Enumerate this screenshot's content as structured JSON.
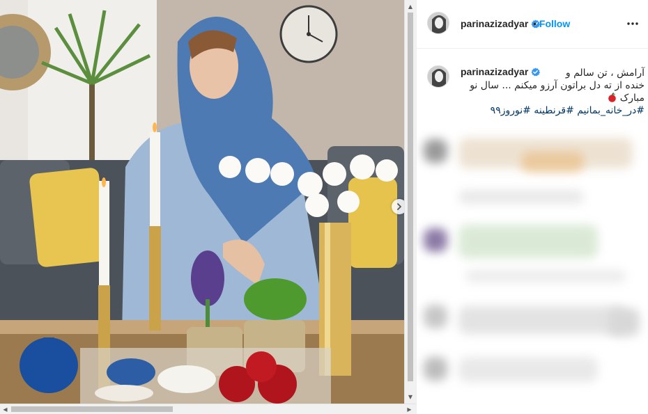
{
  "post": {
    "username": "parinazizadyar",
    "follow_separator": "•",
    "follow_label": "Follow",
    "caption_line1": "آرامش ، تن سالم و",
    "caption_line2": "خنده از ته دل براتون آرزو میکنم ... سال نو",
    "caption_line3": "مبارک",
    "hashtags": "#در_خانه_بمانیم #قرنطینه #نوروز۹۹"
  },
  "icons": {
    "verified": "verified-badge-icon",
    "more": "more-options-icon",
    "next": "chevron-right-icon",
    "emoji": "red-apple-icon",
    "scroll_up": "scroll-up-arrow-icon",
    "scroll_down": "scroll-down-arrow-icon",
    "scroll_left": "scroll-left-arrow-icon",
    "scroll_right": "scroll-right-arrow-icon"
  },
  "colors": {
    "link_blue": "#0095f6",
    "hashtag": "#00376b",
    "verified": "#3897f0",
    "scrollbar_track": "#f1f1f1",
    "scrollbar_thumb": "#c1c1c1"
  }
}
